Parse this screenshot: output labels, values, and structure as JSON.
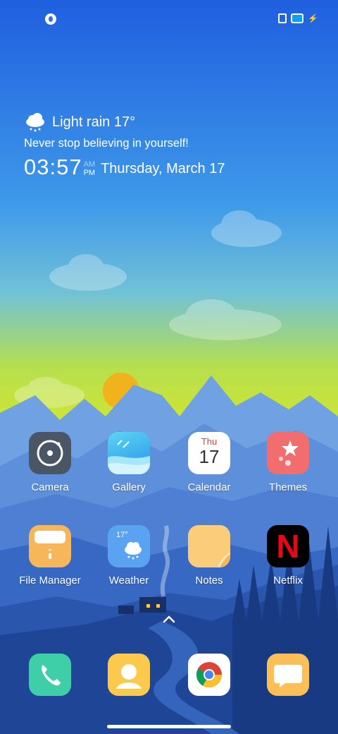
{
  "weather": {
    "condition": "Light rain 17°",
    "motto": "Never stop believing in yourself!",
    "time": "03:57",
    "am": "AM",
    "pm": "PM",
    "date": "Thursday, March 17",
    "icon": "cloud-rain-icon"
  },
  "apps_row1": [
    {
      "label": "Camera",
      "icon": "camera-icon"
    },
    {
      "label": "Gallery",
      "icon": "gallery-icon"
    },
    {
      "label": "Calendar",
      "icon": "calendar-icon",
      "day": "Thu",
      "date": "17"
    },
    {
      "label": "Themes",
      "icon": "themes-icon"
    }
  ],
  "apps_row2": [
    {
      "label": "File Manager",
      "icon": "file-manager-icon"
    },
    {
      "label": "Weather",
      "icon": "weather-icon",
      "temp": "17°"
    },
    {
      "label": "Notes",
      "icon": "notes-icon"
    },
    {
      "label": "Netflix",
      "icon": "netflix-icon",
      "letter": "N"
    }
  ],
  "dock": [
    {
      "name": "phone-icon"
    },
    {
      "name": "contacts-icon"
    },
    {
      "name": "chrome-icon"
    },
    {
      "name": "messages-icon"
    }
  ],
  "colors": {
    "sky_top": "#1f63e0",
    "sky_mid": "#58b6e6",
    "sky_low": "#c8e63a",
    "sun": "#f0b31b",
    "mountain_far": "#6c9ee0",
    "mountain_near": "#1d3f8a"
  }
}
